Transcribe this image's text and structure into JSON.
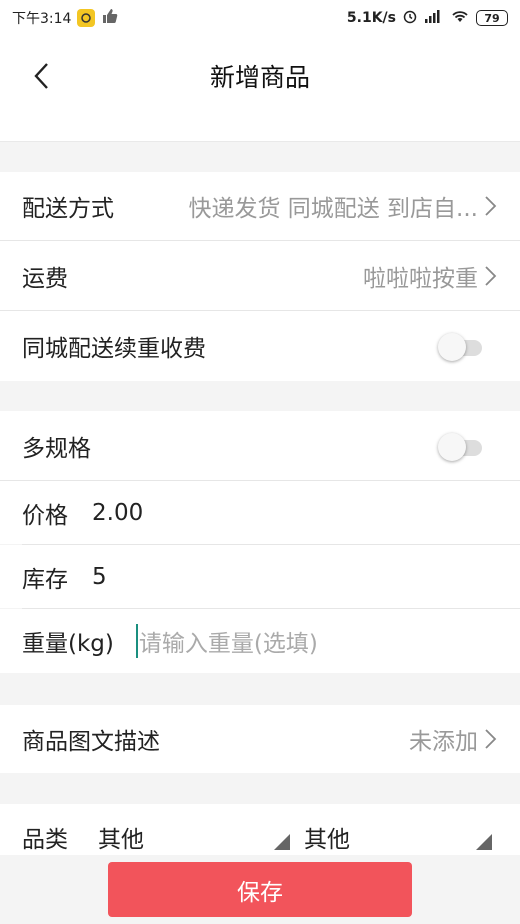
{
  "status_bar": {
    "time": "下午3:14",
    "network_speed": "5.1K/s",
    "battery": "79"
  },
  "nav": {
    "title": "新增商品"
  },
  "rows": {
    "delivery": {
      "label": "配送方式",
      "value": "快递发货 同城配送 到店自..."
    },
    "shipping_fee": {
      "label": "运费",
      "value": "啦啦啦按重"
    },
    "city_weight_fee": {
      "label": "同城配送续重收费",
      "toggle_on": false
    },
    "multi_spec": {
      "label": "多规格",
      "toggle_on": false
    },
    "price": {
      "label": "价格",
      "value": "2.00"
    },
    "stock": {
      "label": "库存",
      "value": "5"
    },
    "weight": {
      "label": "重量(kg)",
      "placeholder": "请输入重量(选填)"
    },
    "description": {
      "label": "商品图文描述",
      "value": "未添加"
    },
    "category": {
      "label": "品类",
      "value1": "其他",
      "value2": "其他"
    }
  },
  "footer": {
    "save_label": "保存"
  },
  "colors": {
    "accent": "#f2545b",
    "cursor": "#1a8f7f"
  }
}
